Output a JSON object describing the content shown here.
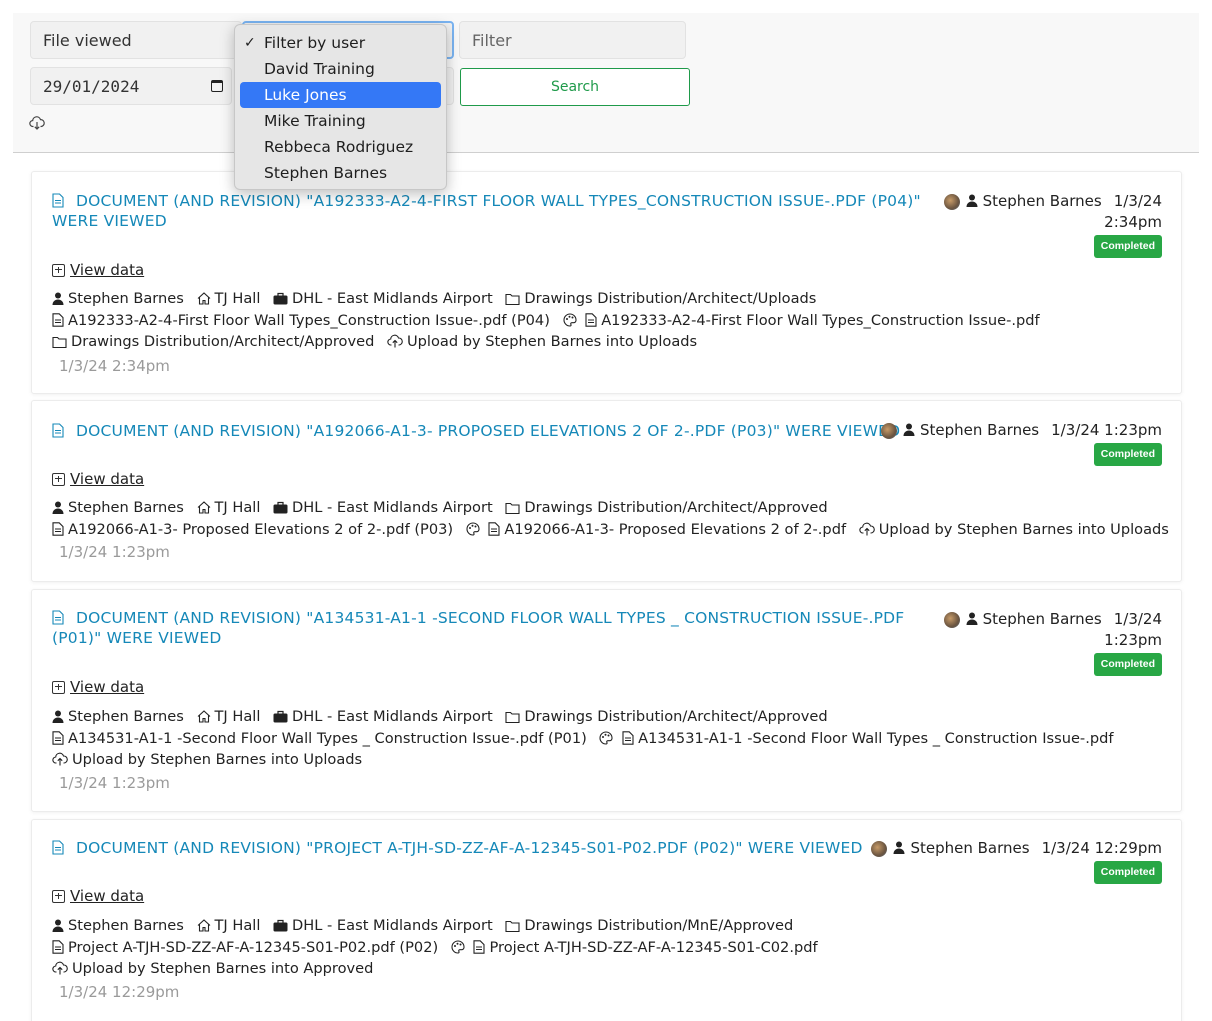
{
  "filters": {
    "type_value": "File viewed",
    "user_value": "Filter by user",
    "filter_placeholder": "Filter",
    "date_value": "29/01/2024",
    "search_label": "Search"
  },
  "user_dropdown": {
    "options": [
      "Filter by user",
      "David Training",
      "Luke Jones",
      "Mike Training",
      "Rebbeca Rodriguez",
      "Stephen Barnes"
    ],
    "checked": "Filter by user",
    "highlighted": "Luke Jones"
  },
  "entries": [
    {
      "title_line1": "Document (and revision) \"A192333-A2-4-First Floor Wall Types_Construction Issue-.pdf (P04)\"",
      "title_line2": "were viewed",
      "user": "Stephen Barnes",
      "when_line1": "1/3/24",
      "when_line2": "2:34pm",
      "status": "Completed",
      "view_data": "View data",
      "person": "Stephen Barnes",
      "site": "TJ Hall",
      "project": "DHL - East Midlands Airport",
      "folder": "Drawings Distribution/Architect/Uploads",
      "file": "A192333-A2-4-First Floor Wall Types_Construction Issue-.pdf (P04)",
      "linked_file": "A192333-A2-4-First Floor Wall Types_Construction Issue-.pdf",
      "dest_folder": "Drawings Distribution/Architect/Approved",
      "upload": "Upload by Stephen Barnes into Uploads",
      "timestamp": "1/3/24 2:34pm"
    },
    {
      "title_line1": "Document (and revision) \"A192066-A1-3- Proposed Elevations 2 of 2-.pdf (P03)\" were viewed",
      "user": "Stephen Barnes",
      "when_line1": "1/3/24 1:23pm",
      "status": "Completed",
      "view_data": "View data",
      "person": "Stephen Barnes",
      "site": "TJ Hall",
      "project": "DHL - East Midlands Airport",
      "folder": "Drawings Distribution/Architect/Approved",
      "file": "A192066-A1-3- Proposed Elevations 2 of 2-.pdf (P03)",
      "linked_file": "A192066-A1-3- Proposed Elevations 2 of 2-.pdf",
      "upload": "Upload by Stephen Barnes into Uploads",
      "timestamp": "1/3/24 1:23pm"
    },
    {
      "title_line1": "Document (and revision) \"A134531-A1-1 -Second Floor Wall Types _ Construction Issue-.pdf",
      "title_line2": "(P01)\" were viewed",
      "user": "Stephen Barnes",
      "when_line1": "1/3/24",
      "when_line2": "1:23pm",
      "status": "Completed",
      "view_data": "View data",
      "person": "Stephen Barnes",
      "site": "TJ Hall",
      "project": "DHL - East Midlands Airport",
      "folder": "Drawings Distribution/Architect/Approved",
      "file": "A134531-A1-1 -Second Floor Wall Types _ Construction Issue-.pdf (P01)",
      "linked_file": "A134531-A1-1 -Second Floor Wall Types _ Construction Issue-.pdf",
      "upload": "Upload by Stephen Barnes into Uploads",
      "timestamp": "1/3/24 1:23pm"
    },
    {
      "title_line1": "Document (and revision) \"Project A-TJH-SD-ZZ-AF-A-12345-S01-P02.pdf (P02)\" were viewed",
      "user": "Stephen Barnes",
      "when_line1": "1/3/24 12:29pm",
      "status": "Completed",
      "view_data": "View data",
      "person": "Stephen Barnes",
      "site": "TJ Hall",
      "project": "DHL - East Midlands Airport",
      "folder": "Drawings Distribution/MnE/Approved",
      "file": "Project A-TJH-SD-ZZ-AF-A-12345-S01-P02.pdf (P02)",
      "linked_file": "Project A-TJH-SD-ZZ-AF-A-12345-S01-C02.pdf",
      "upload": "Upload by Stephen Barnes into Approved",
      "timestamp": "1/3/24 12:29pm"
    }
  ],
  "colors": {
    "title_blue": "#1588b8",
    "status_green": "#28a745",
    "search_green": "#1f9a4a",
    "dropdown_highlight": "#3478f6"
  }
}
